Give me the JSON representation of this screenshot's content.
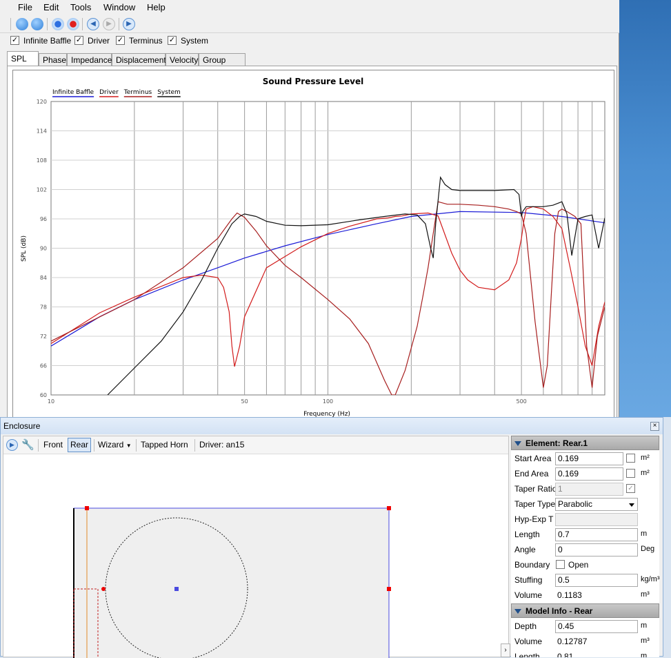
{
  "menu": [
    "File",
    "Edit",
    "Tools",
    "Window",
    "Help"
  ],
  "toolbar_icons": [
    "new-icon",
    "open-icon",
    "record-blue-icon",
    "record-red-icon",
    "back-icon",
    "forward-icon",
    "play-icon"
  ],
  "series_checks": [
    {
      "label": "Infinite Baffle",
      "checked": true
    },
    {
      "label": "Driver",
      "checked": true
    },
    {
      "label": "Terminus",
      "checked": true
    },
    {
      "label": "System",
      "checked": true
    }
  ],
  "tabs": [
    "SPL",
    "Phase",
    "Impedance",
    "Displacement",
    "Velocity",
    "Group Delay"
  ],
  "active_tab": "SPL",
  "chart_data": {
    "type": "line",
    "title": "Sound Pressure Level",
    "xlabel": "Frequency (Hz)",
    "ylabel": "SPL (dB)",
    "xscale": "log",
    "xlim": [
      10,
      1000
    ],
    "ylim": [
      60,
      120
    ],
    "x_tick_labels": [
      "10",
      "50",
      "100",
      "500"
    ],
    "x_ticks": [
      10,
      50,
      100,
      500
    ],
    "y_ticks": [
      60,
      66,
      72,
      78,
      84,
      90,
      96,
      102,
      108,
      114,
      120
    ],
    "legend": [
      "Infinite Baffle",
      "Driver",
      "Terminus",
      "System"
    ],
    "legend_placement": "top-left",
    "grid": true,
    "series": [
      {
        "name": "Infinite Baffle",
        "color": "#1a1ad6",
        "x": [
          10,
          15,
          20,
          30,
          40,
          50,
          70,
          100,
          150,
          200,
          300,
          500,
          700,
          1000
        ],
        "y": [
          70.0,
          76.0,
          79.5,
          83.5,
          86.0,
          88.0,
          90.5,
          92.8,
          95.0,
          96.5,
          97.5,
          97.3,
          96.5,
          95.2
        ]
      },
      {
        "name": "Driver",
        "color": "#d21b1b",
        "x": [
          10,
          15,
          20,
          30,
          35,
          40,
          42,
          44,
          45,
          46,
          48,
          50,
          60,
          80,
          100,
          120,
          150,
          165,
          175,
          185,
          200,
          230,
          250,
          280,
          300,
          320,
          350,
          400,
          450,
          480,
          500,
          510,
          520,
          550,
          600,
          650,
          700,
          750,
          800,
          850,
          900,
          950,
          1000
        ],
        "y": [
          70.5,
          76.8,
          80.0,
          84.0,
          84.5,
          84.0,
          82.0,
          77.0,
          70.0,
          65.8,
          70.0,
          76.0,
          86.0,
          90.3,
          93.0,
          94.5,
          96.0,
          96.2,
          96.5,
          96.6,
          97.0,
          97.2,
          96.6,
          89.0,
          85.5,
          83.5,
          82.0,
          81.5,
          83.5,
          87.0,
          92.0,
          95.5,
          98.0,
          98.5,
          98.0,
          96.5,
          94.0,
          86.0,
          78.0,
          70.0,
          66.0,
          74.0,
          79.0
        ]
      },
      {
        "name": "Terminus",
        "color": "#a61d1d",
        "x": [
          10,
          20,
          30,
          40,
          45,
          47,
          50,
          55,
          60,
          70,
          80,
          100,
          120,
          140,
          160,
          170,
          175,
          190,
          210,
          220,
          230,
          240,
          250,
          270,
          300,
          350,
          400,
          450,
          480,
          500,
          520,
          560,
          600,
          620,
          640,
          660,
          680,
          700,
          730,
          780,
          820,
          860,
          900,
          940,
          1000
        ],
        "y": [
          71.0,
          79.5,
          86.0,
          92.0,
          96.0,
          97.2,
          96.3,
          93.5,
          90.5,
          86.5,
          84.0,
          79.5,
          75.5,
          70.5,
          63.0,
          60.0,
          60.0,
          65.0,
          74.0,
          80.0,
          86.0,
          93.0,
          99.5,
          99.0,
          99.0,
          98.8,
          98.5,
          98.0,
          97.5,
          97.0,
          93.0,
          75.0,
          61.5,
          66.0,
          80.0,
          93.0,
          97.5,
          98.0,
          97.5,
          96.5,
          95.0,
          70.0,
          61.5,
          72.0,
          78.0
        ]
      },
      {
        "name": "System",
        "color": "#111111",
        "x": [
          16,
          20,
          25,
          30,
          35,
          40,
          45,
          48,
          50,
          55,
          60,
          70,
          80,
          100,
          130,
          160,
          190,
          210,
          225,
          235,
          240,
          245,
          255,
          265,
          280,
          300,
          400,
          470,
          490,
          500,
          505,
          520,
          600,
          650,
          700,
          730,
          760,
          800,
          850,
          900,
          950,
          1000
        ],
        "y": [
          60.0,
          65.5,
          71.0,
          77.0,
          83.5,
          90.0,
          95.0,
          96.5,
          97.0,
          96.5,
          95.5,
          94.7,
          94.6,
          94.8,
          95.8,
          96.5,
          97.0,
          96.8,
          95.0,
          90.0,
          88.0,
          95.0,
          104.5,
          103.0,
          102.0,
          101.8,
          101.8,
          102.0,
          101.0,
          96.5,
          97.5,
          98.5,
          98.5,
          98.8,
          99.5,
          97.0,
          88.5,
          96.0,
          96.5,
          96.8,
          90.0,
          96.2
        ]
      }
    ]
  },
  "enclosure": {
    "title": "Enclosure",
    "toolbar": {
      "front": "Front",
      "rear": "Rear",
      "wizard": "Wizard",
      "tapped_horn": "Tapped Horn",
      "driver": "Driver: an15"
    },
    "element_header": "Element: Rear.1",
    "props": {
      "start_area": {
        "label": "Start Area",
        "value": "0.169",
        "unit": "m²"
      },
      "end_area": {
        "label": "End Area",
        "value": "0.169",
        "unit": "m²"
      },
      "taper_ratio": {
        "label": "Taper Ratio",
        "value": "1",
        "check": "✓"
      },
      "taper_type": {
        "label": "Taper Type",
        "value": "Parabolic"
      },
      "hyp_exp": {
        "label": "Hyp-Exp T",
        "value": ""
      },
      "length": {
        "label": "Length",
        "value": "0.7",
        "unit": "m"
      },
      "angle": {
        "label": "Angle",
        "value": "0",
        "unit": "Deg"
      },
      "boundary": {
        "label": "Boundary",
        "option": "Open"
      },
      "stuffing": {
        "label": "Stuffing",
        "value": "0.5",
        "unit": "kg/m³"
      },
      "volume": {
        "label": "Volume",
        "value": "0.1183",
        "unit": "m³"
      }
    },
    "model_header": "Model Info - Rear",
    "model": {
      "depth": {
        "label": "Depth",
        "value": "0.45",
        "unit": "m"
      },
      "volume": {
        "label": "Volume",
        "value": "0.12787",
        "unit": "m³"
      },
      "length": {
        "label": "Length",
        "value": "0.81",
        "unit": "m"
      }
    }
  }
}
